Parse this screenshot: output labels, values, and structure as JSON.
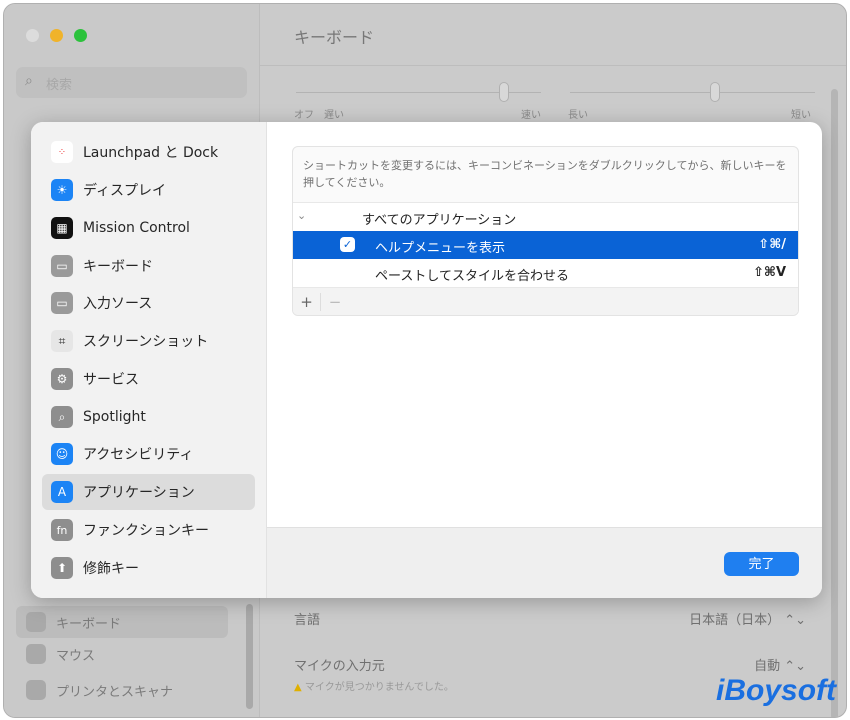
{
  "window": {
    "title": "キーボード",
    "search_placeholder": "検索"
  },
  "background": {
    "slider_labels": [
      "オフ",
      "遅い",
      "速い",
      "長い",
      "短い"
    ],
    "sidebar": [
      "キーボード",
      "マウス",
      "プリンタとスキャナ"
    ],
    "rows": [
      {
        "label": "言語",
        "value": "日本語（日本）"
      },
      {
        "label": "マイクの入力元",
        "value": "自動",
        "warning": "マイクが見つかりませんでした。"
      }
    ]
  },
  "sheet": {
    "sidebar": [
      {
        "label": "Launchpad と Dock",
        "icon": "launchpad-icon"
      },
      {
        "label": "ディスプレイ",
        "icon": "display-icon"
      },
      {
        "label": "Mission Control",
        "icon": "mission-control-icon"
      },
      {
        "label": "キーボード",
        "icon": "keyboard-icon"
      },
      {
        "label": "入力ソース",
        "icon": "input-source-icon"
      },
      {
        "label": "スクリーンショット",
        "icon": "screenshot-icon"
      },
      {
        "label": "サービス",
        "icon": "services-icon"
      },
      {
        "label": "Spotlight",
        "icon": "spotlight-icon"
      },
      {
        "label": "アクセシビリティ",
        "icon": "accessibility-icon"
      },
      {
        "label": "アプリケーション",
        "icon": "app-store-icon",
        "selected": true
      },
      {
        "label": "ファンクションキー",
        "icon": "fn-icon"
      },
      {
        "label": "修飾キー",
        "icon": "modifier-icon"
      }
    ],
    "hint": "ショートカットを変更するには、キーコンビネーションをダブルクリックしてから、新しいキーを押してください。",
    "group": "すべてのアプリケーション",
    "shortcuts": [
      {
        "label": "ヘルプメニューを表示",
        "keys": "⇧⌘/",
        "checked": true,
        "selected": true
      },
      {
        "label": "ペーストしてスタイルを合わせる",
        "keys": "⇧⌘V"
      }
    ],
    "add": "+",
    "remove": "−",
    "done": "完了",
    "accent": "#0a63d6"
  },
  "watermark": "iBoysoft"
}
